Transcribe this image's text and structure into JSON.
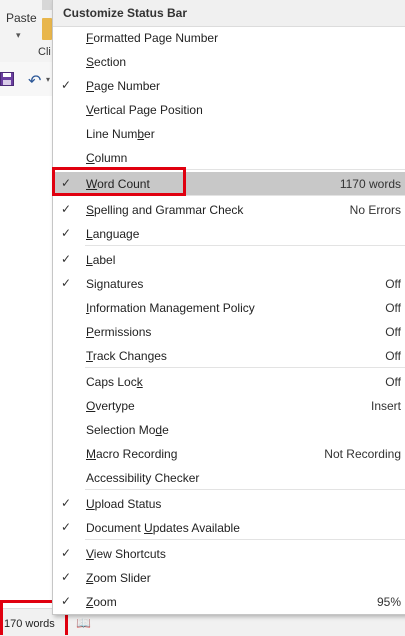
{
  "ribbon": {
    "paste_label": "Paste",
    "clipboard_label": "Cli"
  },
  "menu": {
    "title": "Customize Status Bar",
    "items": [
      {
        "pre": "",
        "u": "F",
        "post": "ormatted Page Number",
        "checked": false,
        "value": ""
      },
      {
        "pre": "",
        "u": "S",
        "post": "ection",
        "checked": false,
        "value": ""
      },
      {
        "pre": "",
        "u": "P",
        "post": "age Number",
        "checked": true,
        "value": ""
      },
      {
        "pre": "",
        "u": "V",
        "post": "ertical Page Position",
        "checked": false,
        "value": ""
      },
      {
        "pre": "Line Num",
        "u": "b",
        "post": "er",
        "checked": false,
        "value": ""
      },
      {
        "pre": "",
        "u": "C",
        "post": "olumn",
        "checked": false,
        "value": ""
      },
      {
        "pre": "",
        "u": "W",
        "post": "ord Count",
        "checked": true,
        "value": "1170 words"
      },
      {
        "pre": "",
        "u": "S",
        "post": "pelling and Grammar Check",
        "checked": true,
        "value": "No Errors"
      },
      {
        "pre": "",
        "u": "L",
        "post": "anguage",
        "checked": true,
        "value": ""
      },
      {
        "pre": "",
        "u": "L",
        "post": "abel",
        "checked": true,
        "value": ""
      },
      {
        "pre": "Si",
        "u": "g",
        "post": "natures",
        "checked": true,
        "value": "Off"
      },
      {
        "pre": "",
        "u": "I",
        "post": "nformation Management Policy",
        "checked": false,
        "value": "Off"
      },
      {
        "pre": "",
        "u": "P",
        "post": "ermissions",
        "checked": false,
        "value": "Off"
      },
      {
        "pre": "",
        "u": "T",
        "post": "rack Changes",
        "checked": false,
        "value": "Off"
      },
      {
        "pre": "Caps Loc",
        "u": "k",
        "post": "",
        "checked": false,
        "value": "Off"
      },
      {
        "pre": "",
        "u": "O",
        "post": "vertype",
        "checked": false,
        "value": "Insert"
      },
      {
        "pre": "Selection Mo",
        "u": "d",
        "post": "e",
        "checked": false,
        "value": ""
      },
      {
        "pre": "",
        "u": "M",
        "post": "acro Recording",
        "checked": false,
        "value": "Not Recording"
      },
      {
        "pre": "Accessibility Checker",
        "u": "",
        "post": "",
        "checked": false,
        "value": ""
      },
      {
        "pre": "",
        "u": "U",
        "post": "pload Status",
        "checked": true,
        "value": ""
      },
      {
        "pre": "Document ",
        "u": "U",
        "post": "pdates Available",
        "checked": true,
        "value": ""
      },
      {
        "pre": "",
        "u": "V",
        "post": "iew Shortcuts",
        "checked": true,
        "value": ""
      },
      {
        "pre": "",
        "u": "Z",
        "post": "oom Slider",
        "checked": true,
        "value": ""
      },
      {
        "pre": "",
        "u": "Z",
        "post": "oom",
        "checked": true,
        "value": "95%"
      }
    ]
  },
  "statusbar": {
    "word_count": "170 words"
  },
  "icons": {
    "check": "checkmark-icon",
    "save": "save-icon",
    "undo": "undo-icon",
    "proofing": "proofing-icon"
  },
  "colors": {
    "highlight": "#e0000f",
    "hover": "#c8c8c8",
    "accent": "#2b5797"
  }
}
